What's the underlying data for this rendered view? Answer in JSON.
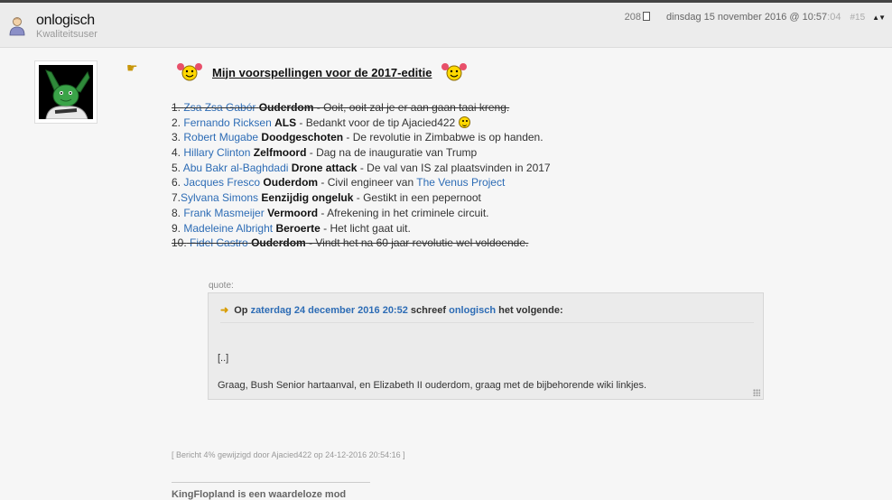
{
  "post": {
    "username": "onlogisch",
    "user_title": "Kwaliteitsuser",
    "post_count": "208",
    "date": "dinsdag 15 november 2016 @ 10:57",
    "seconds": ":04",
    "post_number": "#15",
    "arrows": "▲▼"
  },
  "heading": "Mijn voorspellingen voor de 2017-editie",
  "predictions": [
    {
      "num": "1.",
      "name": "Zsa Zsa Gabór",
      "cause": "Ouderdom",
      "text": " - Ooit, ooit zal je er aan gaan taai kreng."
    },
    {
      "num": "2.",
      "name": "Fernando Ricksen",
      "cause": "ALS",
      "text": " - Bedankt voor de tip Ajacied422 "
    },
    {
      "num": "3.",
      "name": "Robert Mugabe",
      "cause": "Doodgeschoten",
      "text": " - De revolutie in Zimbabwe is op handen."
    },
    {
      "num": "4.",
      "name": "Hillary Clinton",
      "cause": "Zelfmoord",
      "text": " - Dag na de inauguratie van Trump"
    },
    {
      "num": "5.",
      "name": "Abu Bakr al-Baghdadi",
      "cause": "Drone attack",
      "text": " - De val van IS zal plaatsvinden in 2017"
    },
    {
      "num": "6.",
      "name": "Jacques Fresco",
      "cause": "Ouderdom",
      "text": " - Civil engineer van ",
      "link2": "The Venus Project"
    },
    {
      "num": "7.",
      "name": "Sylvana Simons",
      "cause": "Eenzijdig ongeluk",
      "text": " - Gestikt in een pepernoot"
    },
    {
      "num": "8.",
      "name": "Frank Masmeijer",
      "cause": "Vermoord",
      "text": " - Afrekening in het criminele circuit."
    },
    {
      "num": "9.",
      "name": "Madeleine Albright",
      "cause": "Beroerte",
      "text": " - Het licht gaat uit."
    },
    {
      "num": "10.",
      "name": "Fidel Castro",
      "cause": "Ouderdom",
      "text": " - Vindt het na 60 jaar revolutie wel voldoende."
    }
  ],
  "quote": {
    "label": "quote:",
    "prefix": "Op",
    "date_link": "zaterdag 24 december 2016 20:52",
    "middle": "schreef",
    "author_link": "onlogisch",
    "suffix": "het volgende:",
    "ellipsis": "[..]",
    "text": "Graag, Bush Senior hartaanval, en Elizabeth II ouderdom, graag met de bijbehorende wiki linkjes."
  },
  "edit_note": "[ Bericht 4% gewijzigd door Ajacied422 op 24-12-2016 20:54:16 ]",
  "signature": "KingFlopland is een waardeloze mod"
}
